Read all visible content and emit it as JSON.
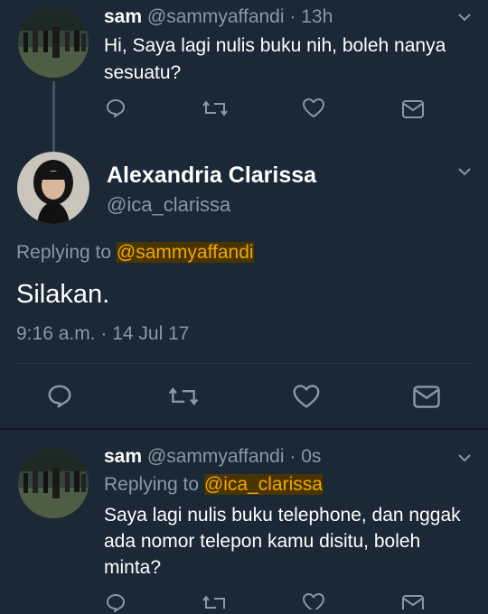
{
  "tweet1": {
    "name": "sam",
    "handle": "@sammyaffandi",
    "separator": "·",
    "time": "13h",
    "text": "Hi, Saya lagi nulis buku nih, boleh nanya sesuatu?"
  },
  "main_tweet": {
    "name": "Alexandria Clarissa",
    "handle": "@ica_clarissa",
    "replying_prefix": "Replying to",
    "replying_to": "@sammyaffandi",
    "text": "Silakan.",
    "timestamp": "9:16 a.m. · 14 Jul 17"
  },
  "tweet3": {
    "name": "sam",
    "handle": "@sammyaffandi",
    "separator": "·",
    "time": "0s",
    "replying_prefix": "Replying to",
    "replying_to": "@ica_clarissa",
    "text": "Saya lagi nulis buku telephone, dan nggak ada nomor telepon kamu disitu, boleh minta?"
  },
  "icons": {
    "reply": "reply-icon",
    "retweet": "retweet-icon",
    "like": "like-icon",
    "message": "message-icon",
    "caret": "chevron-down-icon"
  },
  "colors": {
    "background": "#1b2836",
    "muted": "#8899a6",
    "highlight": "#f2a800",
    "text": "#ffffff"
  }
}
